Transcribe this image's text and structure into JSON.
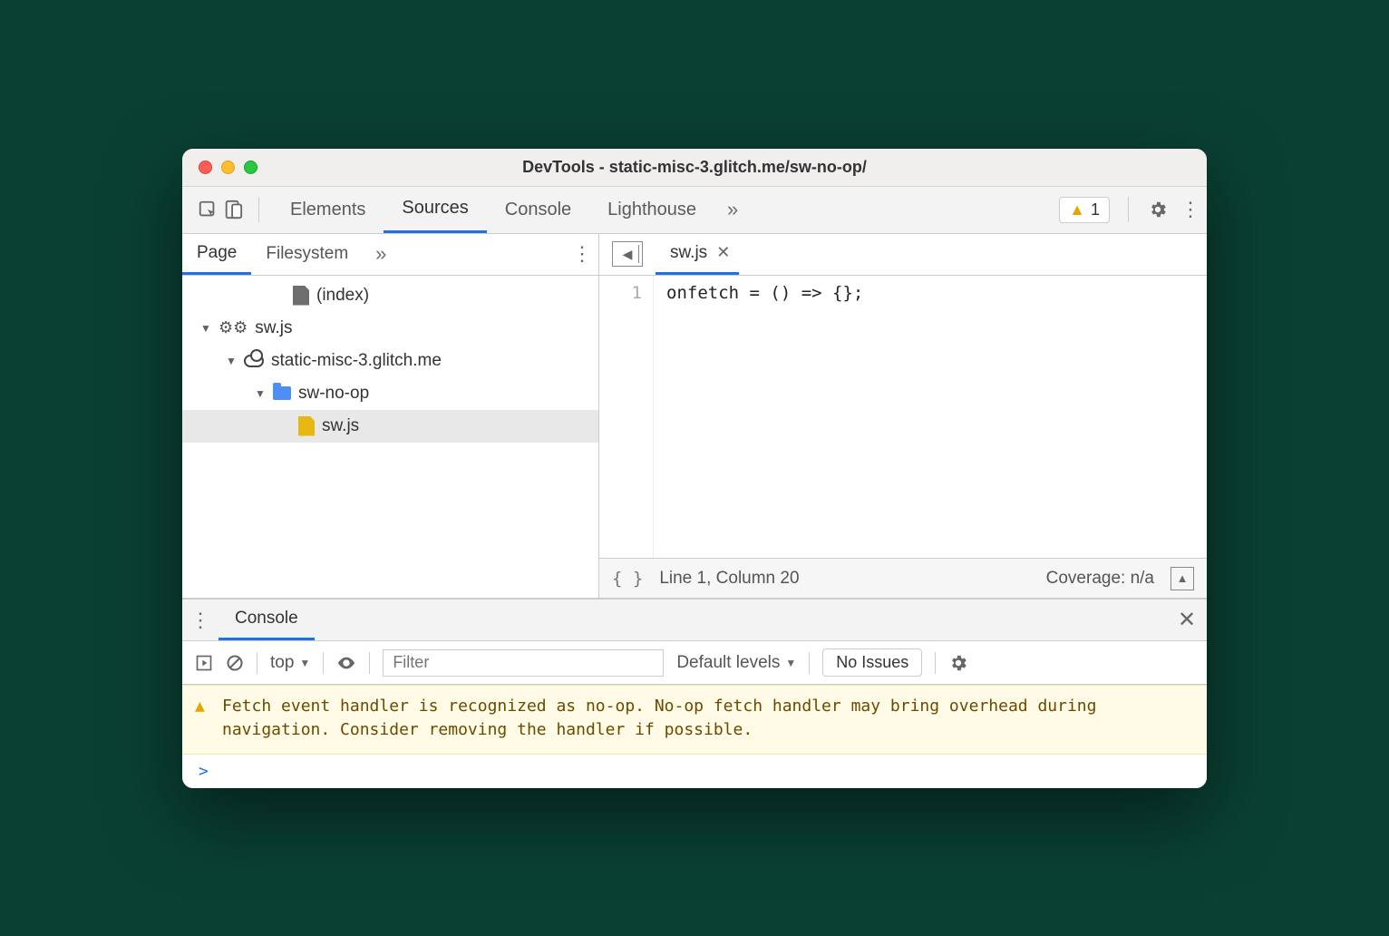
{
  "window": {
    "title": "DevTools - static-misc-3.glitch.me/sw-no-op/"
  },
  "toolbar": {
    "tabs": [
      "Elements",
      "Sources",
      "Console",
      "Lighthouse"
    ],
    "active_tab_index": 1,
    "warning_count": "1"
  },
  "navigator": {
    "tabs": [
      "Page",
      "Filesystem"
    ],
    "active_tab_index": 0,
    "tree": {
      "index_label": "(index)",
      "worker_label": "sw.js",
      "origin_label": "static-misc-3.glitch.me",
      "folder_label": "sw-no-op",
      "file_label": "sw.js"
    }
  },
  "editor": {
    "open_file": "sw.js",
    "line_numbers": [
      "1"
    ],
    "code_line_1": "onfetch = () => {};"
  },
  "status_bar": {
    "format_icon": "{ }",
    "position": "Line 1, Column 20",
    "coverage": "Coverage: n/a"
  },
  "drawer": {
    "tab": "Console"
  },
  "console_toolbar": {
    "context": "top",
    "filter_placeholder": "Filter",
    "levels": "Default levels",
    "issues_button": "No Issues"
  },
  "console": {
    "warning_message": "Fetch event handler is recognized as no-op. No-op fetch handler may bring overhead during navigation. Consider removing the handler if possible.",
    "prompt": ">"
  }
}
